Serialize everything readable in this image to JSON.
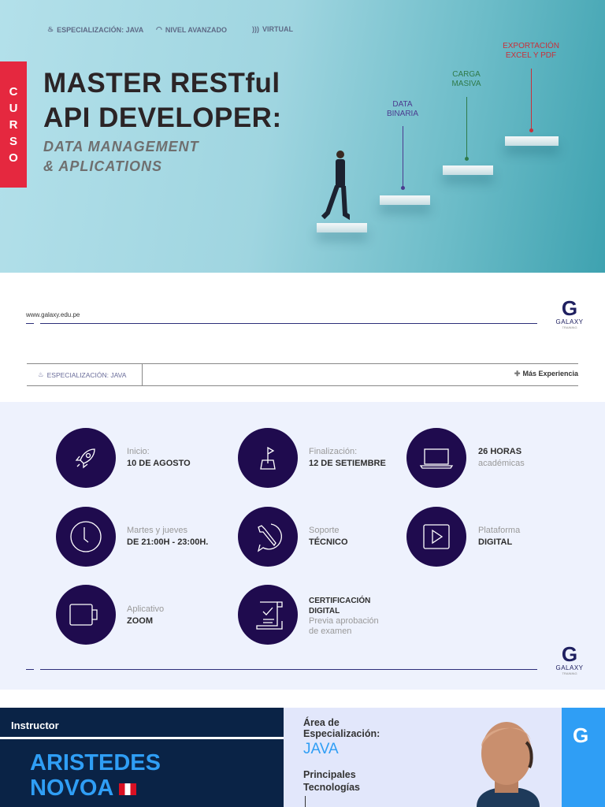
{
  "hero": {
    "tags": [
      "ESPECIALIZACIÓN: JAVA",
      "NIVEL AVANZADO",
      "VIRTUAL"
    ],
    "curso_letters": [
      "C",
      "U",
      "R",
      "S",
      "O"
    ],
    "title_line1": "MASTER RESTful",
    "title_line2": "API DEVELOPER:",
    "subtitle_line1": "DATA MANAGEMENT",
    "subtitle_line2": "& APLICATIONS",
    "steps": [
      {
        "line1": "DATA",
        "line2": "BINARIA",
        "color": "#4b3b8f"
      },
      {
        "line1": "CARGA",
        "line2": "MASIVA",
        "color": "#2f7a4a"
      },
      {
        "line1": "EXPORTACIÓN",
        "line2": "EXCEL Y PDF",
        "color": "#c9303a"
      }
    ]
  },
  "header": {
    "url": "www.galaxy.edu.pe",
    "logo_name": "GALAXY",
    "logo_sub": "TRAINING",
    "band_left": "ESPECIALIZACIÓN: JAVA",
    "band_right": "Más Experiencia"
  },
  "info": [
    {
      "icon": "rocket-icon",
      "label": "Inicio:",
      "value": "10 DE AGOSTO"
    },
    {
      "icon": "flag-icon",
      "label": "Finalización:",
      "value": "12 DE SETIEMBRE"
    },
    {
      "icon": "laptop-icon",
      "value_num": "26",
      "value": "HORAS",
      "label": "académicas"
    },
    {
      "icon": "clock-icon",
      "label": "Martes y jueves",
      "value": "DE 21:00H - 23:00H."
    },
    {
      "icon": "support-icon",
      "label": "Soporte",
      "value": "TÉCNICO"
    },
    {
      "icon": "play-icon",
      "label": "Plataforma",
      "value": "DIGITAL"
    },
    {
      "icon": "camera-icon",
      "label": "Aplicativo",
      "value": "ZOOM"
    },
    {
      "icon": "certificate-icon",
      "value": "CERTIFICACIÓN",
      "value2": "DIGITAL",
      "label": "Previa aprobación",
      "label2": "de examen"
    }
  ],
  "instructor": {
    "heading": "Instructor",
    "first_name": "ARISTEDES",
    "last_name": "NOVOA",
    "area_label1": "Área de",
    "area_label2": "Especialización:",
    "area_value": "JAVA",
    "tech_label1": "Principales",
    "tech_label2": "Tecnologías"
  },
  "colors": {
    "accent_red": "#e5283f",
    "circle": "#1f0b4e",
    "navy": "#0a2346",
    "blue": "#2f9ef5"
  }
}
